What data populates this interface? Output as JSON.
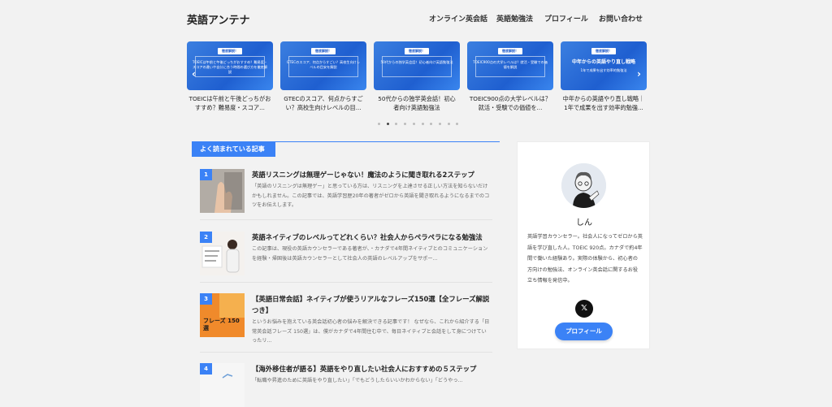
{
  "header": {
    "logo": "英語アンテナ",
    "nav": [
      "オンライン英会話",
      "英語勉強法",
      "プロフィール",
      "お問い合わせ"
    ]
  },
  "carousel": {
    "cards": [
      {
        "badge": "徹底解説！",
        "thumb_text": "TOEICは午前と午後どっちがおすすめ？難易度・スコアの違いや自分に合う時間の選び方を徹底解説",
        "caption": "TOEICは午前と午後どっちがおすすめ？難易度・スコア..."
      },
      {
        "badge": "徹底解説！",
        "thumb_text": "GTECのスコア、何点からすごい？高校生向けレベルの目安を解説",
        "caption": "GTECのスコア、何点からすごい？高校生向けレベルの目..."
      },
      {
        "badge": "徹底解説！",
        "thumb_text": "50代からの独学英会話！初心者向け英語勉強法",
        "caption": "50代からの独学英会話！初心者向け英語勉強法"
      },
      {
        "badge": "徹底解説！",
        "thumb_text": "TOEIC900点の大学レベルは？就活・受験での価値を解説",
        "caption": "TOEIC900点の大学レベルは？就活・受験での価値を..."
      },
      {
        "badge": "徹底解説！",
        "thumb_text": "中年からの英語やり直し戦略",
        "thumb_sub": "1年で成果を出す効率的勉強法",
        "caption": "中年からの英語やり直し戦略｜1年で成果を出す効率的勉強..."
      }
    ],
    "prev_icon": "chevron-left-icon",
    "next_icon": "chevron-right-icon",
    "dot_count": 10,
    "active_dot": 2
  },
  "popular": {
    "heading": "よく読まれている記事",
    "articles": [
      {
        "rank": "1",
        "title": "英語リスニングは無理ゲーじゃない！魔法のように聞き取れる2ステップ",
        "excerpt": "「英語のリスニングは無理ゲー」と思っている方は、リスニングを上達させる正しい方法を知らないだけかもしれません。この記事では、英語学習歴20年の著者がゼロから英語を聞き取れるようになるまでのコツをお伝えします。"
      },
      {
        "rank": "2",
        "title": "英語ネイティブのレベルってどれくらい？社会人からペラペラになる勉強法",
        "excerpt": "この記事は、現役の英語カウンセラーである著者が、・カナダで4年間ネイティブとのコミュニケーションを経験・帰国後は英語カウンセラーとして社会人の英語のレベルアップをサポー..."
      },
      {
        "rank": "3",
        "title": "【英語日常会話】ネイティブが使うリアルなフレーズ150選【全フレーズ解説つき】",
        "excerpt": "というお悩みを抱えている英会話初心者の悩みを解決できる記事です！ なぜなら、これから紹介する「日常英会話フレーズ 150選」は、僕がカナダで4年間住む中で、毎日ネイティブと会話をして身につけていったリ..."
      },
      {
        "rank": "4",
        "title": "【海外移住者が語る】英語をやり直したい社会人におすすめの５ステップ",
        "excerpt": "「転職や昇進のために英語をやり直したい」「でもどうしたらいいかわからない」「どうやっ..."
      }
    ],
    "thumb3_text": "フレーズ 150選"
  },
  "profile": {
    "name": "しん",
    "bio": "英語学習カウンセラー。社会人になってゼロから英語を学び直した人。TOEIC 920点。カナダで約4年間で働いた経験あり。実際の体験から、初心者の方向けの勉強法、オンライン英会話に関するお役立ち情報を発信中。",
    "x_icon": "x-logo-icon",
    "button": "プロフィール"
  },
  "colors": {
    "accent": "#3b82f6",
    "thumb_blue": "#2a6ad8",
    "background": "#f2f2f2"
  }
}
